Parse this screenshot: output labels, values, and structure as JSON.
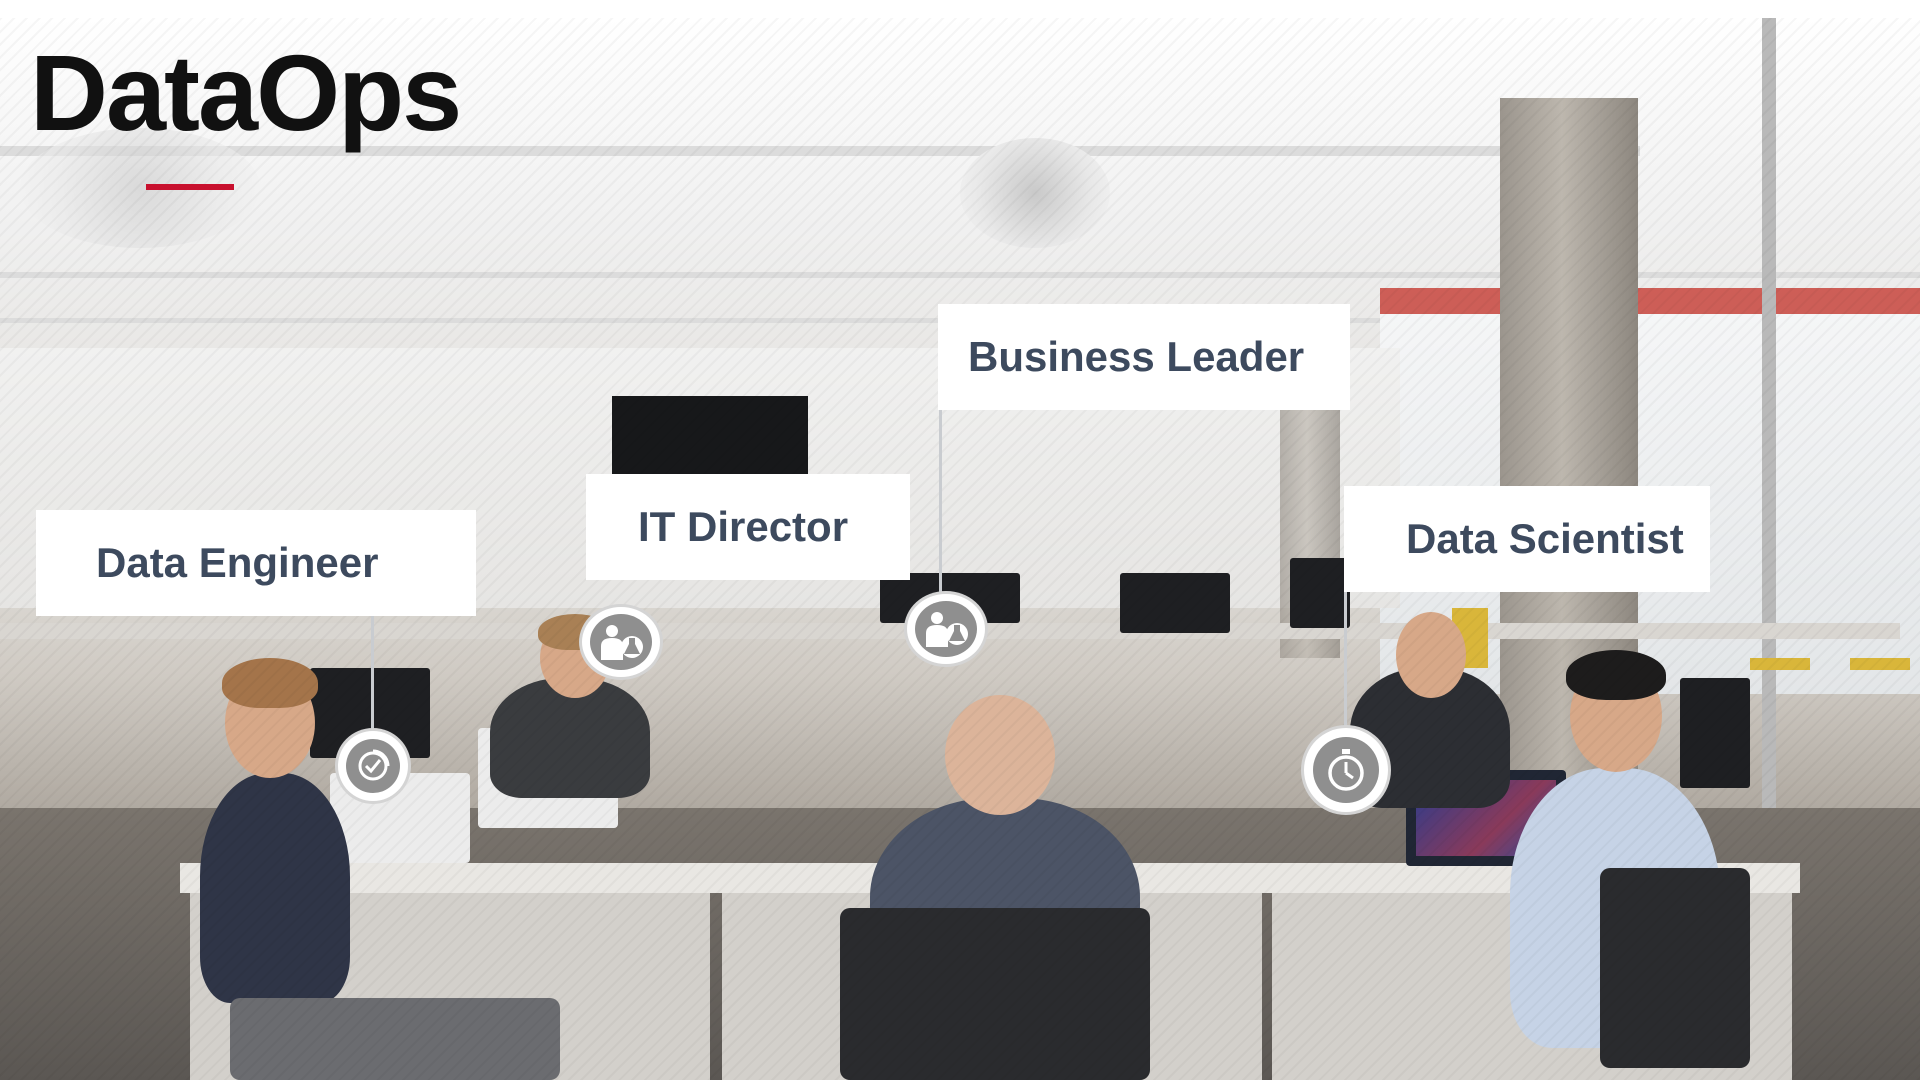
{
  "slide": {
    "title": "DataOps",
    "accent_color": "#c8102e"
  },
  "roles": [
    {
      "label": "Data Engineer",
      "icon": "clock-check-icon"
    },
    {
      "label": "IT Director",
      "icon": "person-flask-icon"
    },
    {
      "label": "Business Leader",
      "icon": "person-flask-icon"
    },
    {
      "label": "Data Scientist",
      "icon": "stopwatch-icon"
    }
  ],
  "colors": {
    "label_text": "#3d4a5e",
    "label_background": "#ffffff"
  }
}
